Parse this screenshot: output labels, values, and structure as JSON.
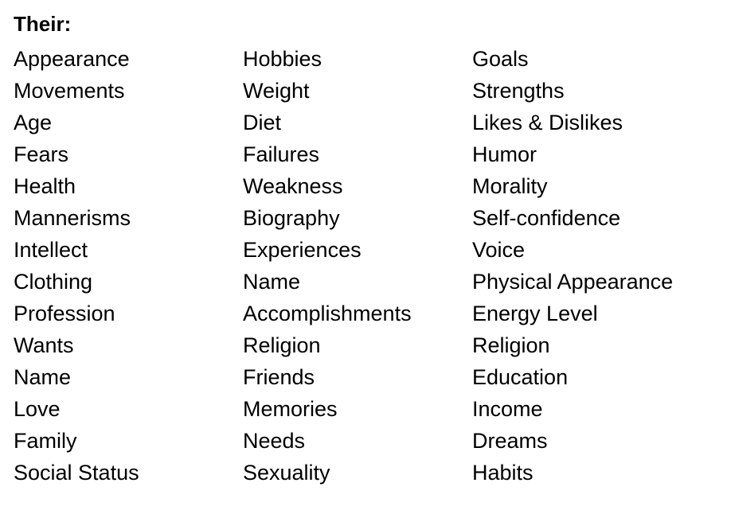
{
  "heading": "Their:",
  "columns": [
    [
      "Appearance",
      "Movements",
      "Age",
      "Fears",
      "Health",
      "Mannerisms",
      "Intellect",
      "Clothing",
      "Profession",
      "Wants",
      "Name",
      "Love",
      "Family",
      "Social Status"
    ],
    [
      "Hobbies",
      "Weight",
      "Diet",
      "Failures",
      "Weakness",
      "Biography",
      "Experiences",
      "Name",
      "Accomplishments",
      "Religion",
      "Friends",
      "Memories",
      "Needs",
      "Sexuality"
    ],
    [
      "Goals",
      "Strengths",
      "Likes & Dislikes",
      "Humor",
      "Morality",
      "Self-confidence",
      "Voice",
      "Physical Appearance",
      "Energy Level",
      "Religion",
      "Education",
      "Income",
      "Dreams",
      "Habits"
    ]
  ]
}
